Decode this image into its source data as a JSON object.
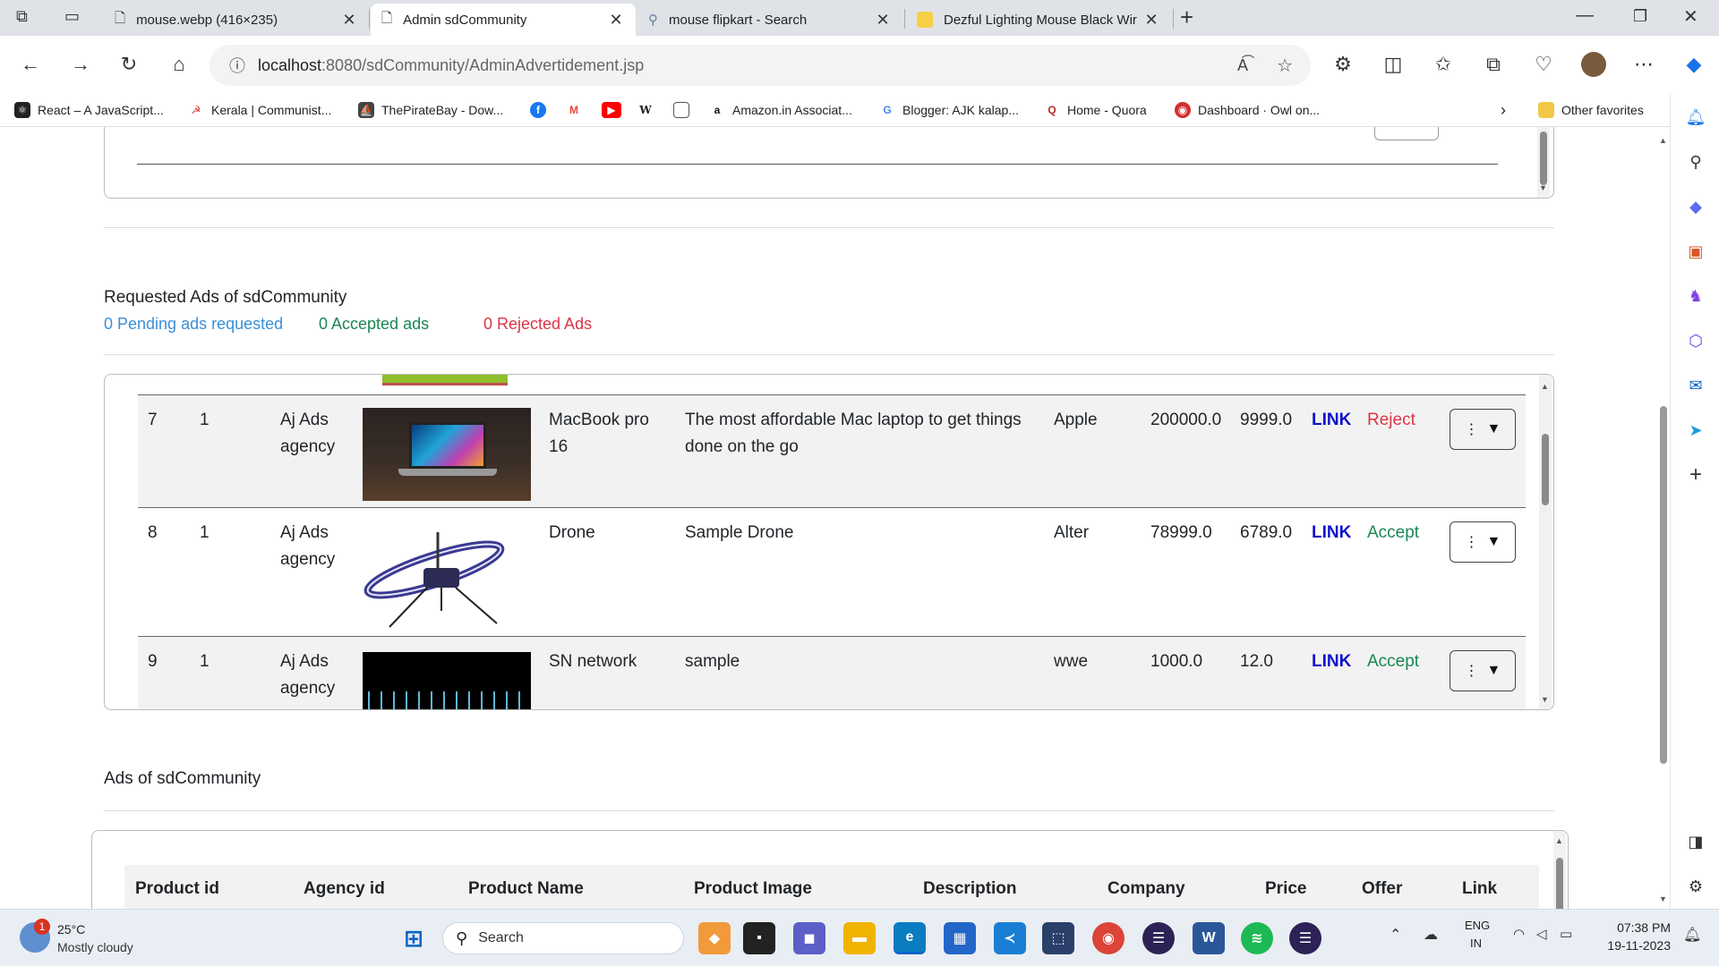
{
  "tabs": [
    {
      "title": "mouse.webp (416×235)",
      "icon": "document-icon"
    },
    {
      "title": "Admin sdCommunity",
      "icon": "document-icon"
    },
    {
      "title": "mouse flipkart - Search",
      "icon": "search-icon"
    },
    {
      "title": "Dezful Lighting Mouse Black Wir",
      "icon": "flipkart-icon"
    }
  ],
  "address": {
    "host": "localhost",
    "path": ":8080/sdCommunity/AdminAdvertidement.jsp"
  },
  "bookmarks": [
    {
      "label": "React – A JavaScript...",
      "color": "#222"
    },
    {
      "label": "Kerala | Communist...",
      "color": "#d32f2f"
    },
    {
      "label": "ThePirateBay - Dow...",
      "color": "#444"
    },
    {
      "label": "",
      "color": "#1877f2"
    },
    {
      "label": "",
      "color": "#ea4335"
    },
    {
      "label": "",
      "color": "#ff0000"
    },
    {
      "label": "",
      "color": "#333"
    },
    {
      "label": "",
      "color": "#555"
    },
    {
      "label": "Amazon.in Associat...",
      "color": "#111"
    },
    {
      "label": "Blogger: AJK kalap...",
      "color": "#f57c00"
    },
    {
      "label": "Home - Quora",
      "color": "#b92b27"
    },
    {
      "label": "Dashboard · Owl on...",
      "color": "#d32f2f"
    }
  ],
  "other_favorites": "Other favorites",
  "requested": {
    "title": "Requested Ads of sdCommunity",
    "pending": "0 Pending ads requested",
    "accepted": "0 Accepted ads",
    "rejected": "0 Rejected Ads"
  },
  "rows": [
    {
      "id": "7",
      "agency_id": "1",
      "agency": "Aj Ads agency",
      "name": "MacBook pro 16",
      "desc": "The most affordable Mac laptop to get things done on the go",
      "company": "Apple",
      "price": "200000.0",
      "offer": "9999.0",
      "link": "LINK",
      "action": "Reject"
    },
    {
      "id": "8",
      "agency_id": "1",
      "agency": "Aj Ads agency",
      "name": "Drone",
      "desc": "Sample Drone",
      "company": "Alter",
      "price": "78999.0",
      "offer": "6789.0",
      "link": "LINK",
      "action": "Accept"
    },
    {
      "id": "9",
      "agency_id": "1",
      "agency": "Aj Ads agency",
      "name": "SN network",
      "desc": "sample",
      "company": "wwe",
      "price": "1000.0",
      "offer": "12.0",
      "link": "LINK",
      "action": "Accept"
    }
  ],
  "ads": {
    "title": "Ads of sdCommunity",
    "headers": [
      "Product id",
      "Agency id",
      "Product Name",
      "Product Image",
      "Description",
      "Company",
      "Price",
      "Offer",
      "Link"
    ]
  },
  "taskbar": {
    "temp": "25°C",
    "weather": "Mostly cloudy",
    "badge": "1",
    "search": "Search",
    "lang1": "ENG",
    "lang2": "IN",
    "time": "07:38 PM",
    "date": "19-11-2023"
  },
  "colors": {
    "link": "#0d12c9",
    "reject": "#dc3545",
    "accept": "#198754",
    "pending": "#3b8fd6"
  }
}
